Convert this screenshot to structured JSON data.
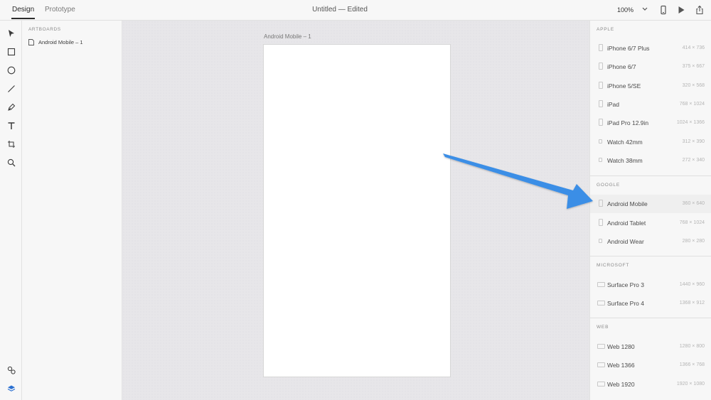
{
  "header": {
    "tabs": [
      {
        "label": "Design"
      },
      {
        "label": "Prototype"
      }
    ],
    "title": "Untitled — Edited",
    "zoom": "100%"
  },
  "layers": {
    "heading": "ARTBOARDS",
    "items": [
      {
        "label": "Android Mobile – 1"
      }
    ]
  },
  "canvas": {
    "artboard_label": "Android Mobile – 1"
  },
  "presets": {
    "apple": {
      "heading": "APPLE",
      "items": [
        {
          "name": "iPhone 6/7 Plus",
          "size": "414 × 736"
        },
        {
          "name": "iPhone 6/7",
          "size": "375 × 667"
        },
        {
          "name": "iPhone 5/SE",
          "size": "320 × 568"
        },
        {
          "name": "iPad",
          "size": "768 × 1024"
        },
        {
          "name": "iPad Pro 12.9in",
          "size": "1024 × 1366"
        },
        {
          "name": "Watch 42mm",
          "size": "312 × 390"
        },
        {
          "name": "Watch 38mm",
          "size": "272 × 340"
        }
      ]
    },
    "google": {
      "heading": "GOOGLE",
      "items": [
        {
          "name": "Android Mobile",
          "size": "360 × 640"
        },
        {
          "name": "Android Tablet",
          "size": "768 × 1024"
        },
        {
          "name": "Android Wear",
          "size": "280 × 280"
        }
      ]
    },
    "microsoft": {
      "heading": "MICROSOFT",
      "items": [
        {
          "name": "Surface Pro 3",
          "size": "1440 × 960"
        },
        {
          "name": "Surface Pro 4",
          "size": "1368 × 912"
        }
      ]
    },
    "web": {
      "heading": "WEB",
      "items": [
        {
          "name": "Web 1280",
          "size": "1280 × 800"
        },
        {
          "name": "Web 1366",
          "size": "1366 × 768"
        },
        {
          "name": "Web 1920",
          "size": "1920 × 1080"
        }
      ]
    }
  },
  "colors": {
    "annotation_arrow": "#3b8ee6",
    "panel_bg": "#f7f7f7",
    "canvas_bg": "#e7e6e9"
  }
}
